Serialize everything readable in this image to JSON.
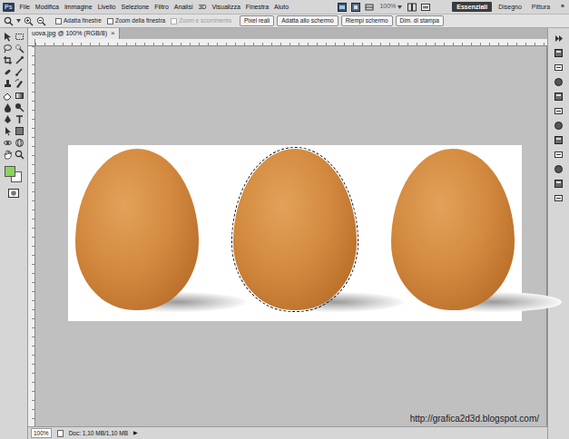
{
  "menu": {
    "logo": "Ps",
    "items": [
      "File",
      "Modifica",
      "Immagine",
      "Livello",
      "Selezione",
      "Filtro",
      "Analisi",
      "3D",
      "Visualizza",
      "Finestra",
      "Aiuto"
    ]
  },
  "app_bar": {
    "zoom": "100%",
    "workspaces": [
      {
        "label": "Essenziali",
        "selected": true
      },
      {
        "label": "Disegno",
        "selected": false
      },
      {
        "label": "Pittura",
        "selected": false
      }
    ],
    "more": "»"
  },
  "options_bar": {
    "checkboxes": [
      {
        "label": "Adatta finestre",
        "checked": false,
        "disabled": false
      },
      {
        "label": "Zoom della finestra",
        "checked": false,
        "disabled": false
      },
      {
        "label": "Zoom e scorrimento",
        "checked": false,
        "disabled": true
      }
    ],
    "buttons": [
      "Pixel reali",
      "Adatta allo schermo",
      "Riempi schermo",
      "Dim. di stampa"
    ]
  },
  "document": {
    "tab": "uova.jpg @ 100% (RGB/8)",
    "close": "×",
    "eggs": [
      {
        "selected": false
      },
      {
        "selected": true
      },
      {
        "selected": false
      }
    ]
  },
  "colors": {
    "foreground": "#8dd35f",
    "background": "#ffffff"
  },
  "status_bar": {
    "zoom": "100%",
    "info": "Doc: 1,10 MB/1,10 MB",
    "arrow": "▶"
  },
  "watermark": "http://grafica2d3d.blogspot.com/"
}
